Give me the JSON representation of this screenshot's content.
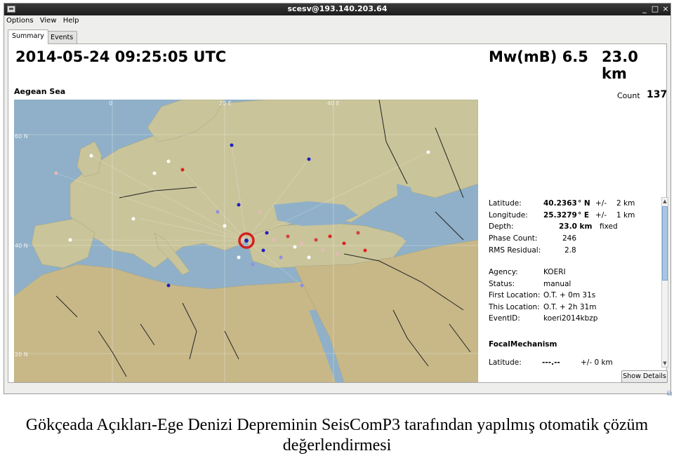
{
  "window": {
    "title": "scesv@193.140.203.64",
    "controls": {
      "minimize": "_",
      "maximize": "□",
      "close": "×"
    }
  },
  "menu": [
    "Options",
    "View",
    "Help"
  ],
  "tabs": [
    "Summary",
    "Events"
  ],
  "summary": {
    "datetime": "2014-05-24 09:25:05 UTC",
    "magnitude": "Mw(mB) 6.5",
    "depth_big": "23.0 km",
    "region": "Aegean Sea",
    "count_label": "Count",
    "count_value": "137"
  },
  "map": {
    "lon_labels": [
      "0",
      "20 E",
      "40 E"
    ],
    "lat_labels": [
      "60 N",
      "40 N",
      "20 N"
    ],
    "colors": {
      "sea": "#8fb0c8",
      "land": "#c9c49a",
      "highlight": "#d42020"
    }
  },
  "details": {
    "latitude": {
      "label": "Latitude:",
      "value": "40.2363",
      "unit": "° N",
      "pm": "+/-",
      "err": "2 km"
    },
    "longitude": {
      "label": "Longitude:",
      "value": "25.3279",
      "unit": "° E",
      "pm": "+/-",
      "err": "1 km"
    },
    "depth": {
      "label": "Depth:",
      "value": "23.0 km",
      "note": "fixed"
    },
    "phase_count": {
      "label": "Phase Count:",
      "value": "246"
    },
    "rms": {
      "label": "RMS Residual:",
      "value": "2.8"
    },
    "agency": {
      "label": "Agency:",
      "value": "KOERI"
    },
    "status": {
      "label": "Status:",
      "value": "manual"
    },
    "first_location": {
      "label": "First Location:",
      "value": "O.T. + 0m 31s"
    },
    "this_location": {
      "label": "This Location:",
      "value": "O.T. + 2h 31m"
    },
    "event_id": {
      "label": "EventID:",
      "value": "koeri2014kbzp"
    },
    "focal_title": "FocalMechanism",
    "focal_latitude": {
      "label": "Latitude:",
      "value": "---.--",
      "err": "+/- 0 km"
    }
  },
  "show_details_label": "Show Details",
  "caption": "Gökçeada Açıkları-Ege Denizi Depreminin SeisComP3 tarafından yapılmış otomatik çözüm değerlendirmesi"
}
